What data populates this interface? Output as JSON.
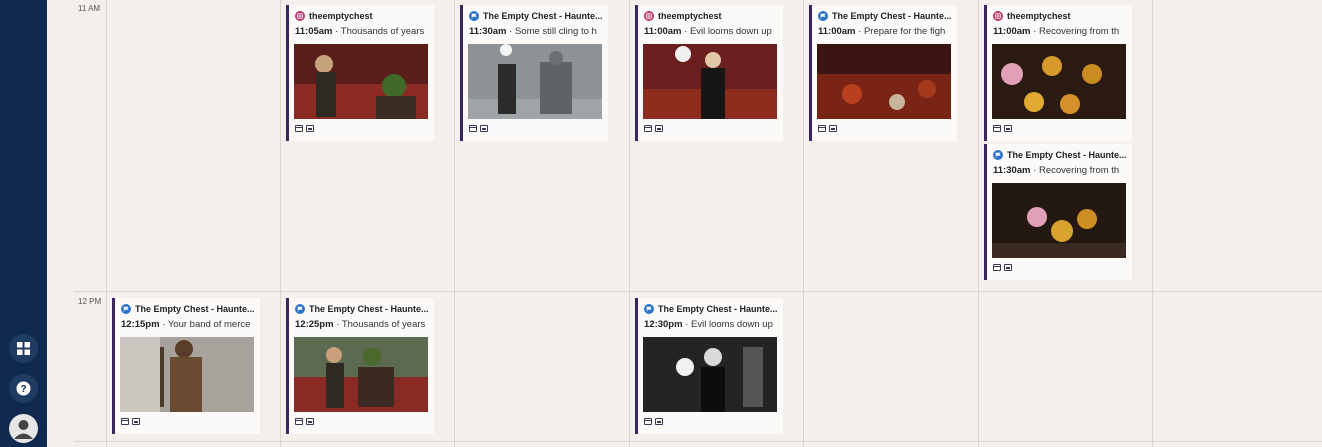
{
  "time_labels": {
    "t11": "11 AM",
    "t12": "12 PM"
  },
  "colors": {
    "sidebar": "#0f2a4e",
    "instagram": "#c1336b",
    "facebook": "#2a73c8",
    "post_accent": "#3a2560"
  },
  "sidebar": {
    "icons": [
      "grid-icon",
      "help-icon",
      "user-avatar-icon"
    ]
  },
  "posts": [
    {
      "account": "theemptychest",
      "network": "instagram",
      "time": "11:05am",
      "text": " · Thousands of years"
    },
    {
      "account": "The Empty Chest - Haunte...",
      "network": "facebook",
      "time": "11:30am",
      "text": " · Some still cling to h"
    },
    {
      "account": "theemptychest",
      "network": "instagram",
      "time": "11:00am",
      "text": " · Evil looms down up"
    },
    {
      "account": "The Empty Chest - Haunte...",
      "network": "facebook",
      "time": "11:00am",
      "text": " · Prepare for the figh"
    },
    {
      "account": "theemptychest",
      "network": "instagram",
      "time": "11:00am",
      "text": " · Recovering from th"
    },
    {
      "account": "The Empty Chest - Haunte...",
      "network": "facebook",
      "time": "11:30am",
      "text": " · Recovering from th"
    },
    {
      "account": "The Empty Chest - Haunte...",
      "network": "facebook",
      "time": "12:15pm",
      "text": " · Your band of merce"
    },
    {
      "account": "The Empty Chest - Haunte...",
      "network": "facebook",
      "time": "12:25pm",
      "text": " · Thousands of years"
    },
    {
      "account": "The Empty Chest - Haunte...",
      "network": "facebook",
      "time": "12:30pm",
      "text": " · Evil looms down up"
    }
  ]
}
